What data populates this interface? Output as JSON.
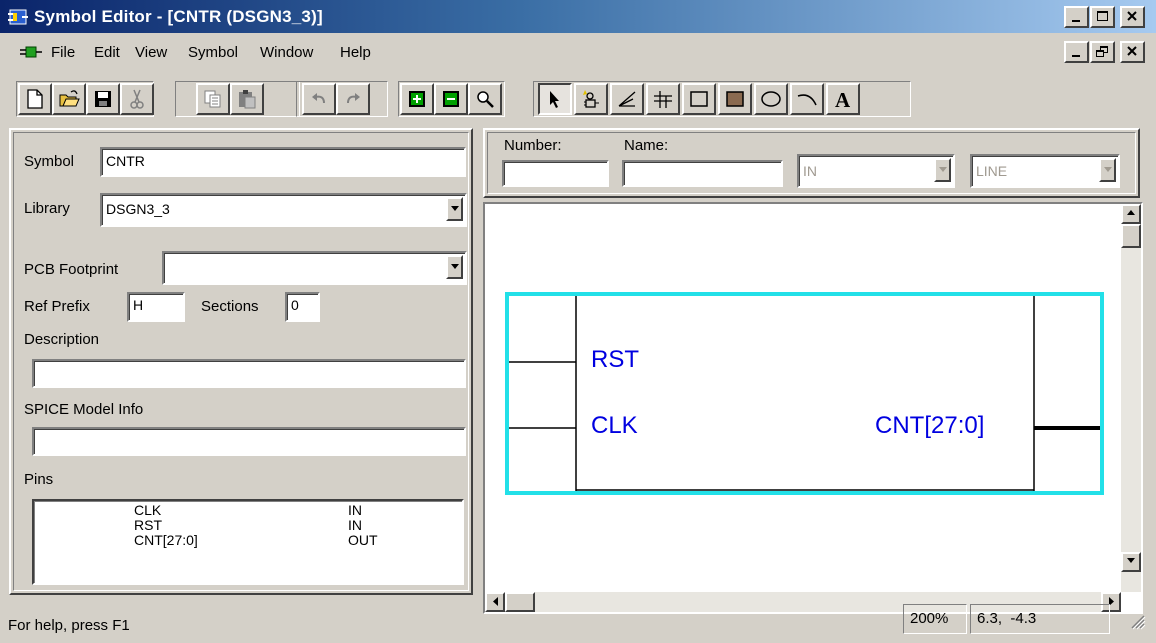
{
  "window": {
    "title": "Symbol Editor - [CNTR (DSGN3_3)]"
  },
  "menu": {
    "items": [
      "File",
      "Edit",
      "View",
      "Symbol",
      "Window",
      "Help"
    ]
  },
  "toolbar": {
    "icons": [
      "new-icon",
      "open-icon",
      "save-icon",
      "cut-icon",
      "copy-icon",
      "paste-icon",
      "undo-icon",
      "redo-icon",
      "zoom-in-icon",
      "zoom-out-icon",
      "zoom-icon",
      "select-arrow-icon",
      "add-pin-icon",
      "wire-icon",
      "grid-icon",
      "rectangle-icon",
      "filled-rectangle-icon",
      "ellipse-icon",
      "arc-icon",
      "text-icon"
    ]
  },
  "properties": {
    "symbol_label": "Symbol",
    "symbol_value": "CNTR",
    "library_label": "Library",
    "library_value": "DSGN3_3",
    "pcb_label": "PCB Footprint",
    "pcb_value": "",
    "refprefix_label": "Ref Prefix",
    "refprefix_value": "H",
    "sections_label": "Sections",
    "sections_value": "0",
    "description_label": "Description",
    "description_value": "",
    "spice_label": "SPICE Model Info",
    "spice_value": "",
    "pins_label": "Pins",
    "pins": [
      {
        "name": "CLK",
        "type": "IN"
      },
      {
        "name": "RST",
        "type": "IN"
      },
      {
        "name": "CNT[27:0]",
        "type": "OUT"
      }
    ]
  },
  "pin_editor": {
    "number_label": "Number:",
    "number_value": "",
    "name_label": "Name:",
    "name_value": "",
    "type_value": "IN",
    "shape_value": "LINE"
  },
  "canvas": {
    "pin_labels": {
      "rst": "RST",
      "clk": "CLK",
      "cnt": "CNT[27:0]"
    },
    "box_color": "#22e0e8",
    "pin_text_color": "#0000e0"
  },
  "status": {
    "help_text": "For help, press F1",
    "zoom": "200%",
    "coords": "6.3,  -4.3"
  }
}
